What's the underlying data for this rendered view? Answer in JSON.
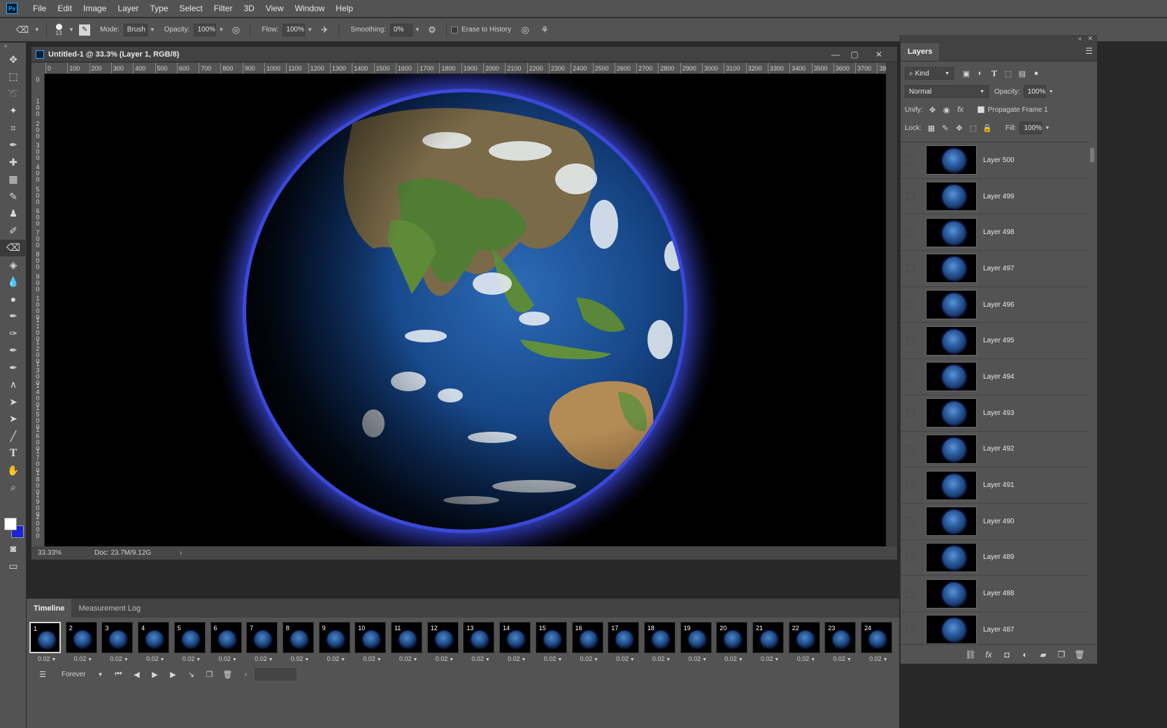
{
  "app": {
    "logo": "Ps"
  },
  "menu": [
    "File",
    "Edit",
    "Image",
    "Layer",
    "Type",
    "Select",
    "Filter",
    "3D",
    "View",
    "Window",
    "Help"
  ],
  "options": {
    "brush_size": "13",
    "mode_label": "Mode:",
    "mode_value": "Brush",
    "opacity_label": "Opacity:",
    "opacity_value": "100%",
    "flow_label": "Flow:",
    "flow_value": "100%",
    "smoothing_label": "Smoothing:",
    "smoothing_value": "0%",
    "erase_history_label": "Erase to History"
  },
  "document": {
    "title": "Untitled-1 @ 33.3% (Layer 1, RGB/8)",
    "zoom": "33.33%",
    "doc_size": "Doc: 23.7M/9.12G",
    "hruler": [
      "0",
      "100",
      "200",
      "300",
      "400",
      "500",
      "600",
      "700",
      "800",
      "900",
      "1000",
      "1100",
      "1200",
      "1300",
      "1400",
      "1500",
      "1600",
      "1700",
      "1800",
      "1900",
      "2000",
      "2100",
      "2200",
      "2300",
      "2400",
      "2500",
      "2600",
      "2700",
      "2800",
      "2900",
      "3000",
      "3100",
      "3200",
      "3300",
      "3400",
      "3500",
      "3600",
      "3700",
      "38"
    ],
    "vruler": [
      "0",
      "100",
      "200",
      "300",
      "400",
      "500",
      "600",
      "700",
      "800",
      "900",
      "1000",
      "1100",
      "1200",
      "1300",
      "1400",
      "1500",
      "1600",
      "1700",
      "1800",
      "1900",
      "2000"
    ]
  },
  "timeline": {
    "tabs": [
      "Timeline",
      "Measurement Log"
    ],
    "frames": [
      {
        "num": "1",
        "delay": "0.02"
      },
      {
        "num": "2",
        "delay": "0.02"
      },
      {
        "num": "3",
        "delay": "0.02"
      },
      {
        "num": "4",
        "delay": "0.02"
      },
      {
        "num": "5",
        "delay": "0.02"
      },
      {
        "num": "6",
        "delay": "0.02"
      },
      {
        "num": "7",
        "delay": "0.02"
      },
      {
        "num": "8",
        "delay": "0.02"
      },
      {
        "num": "9",
        "delay": "0.02"
      },
      {
        "num": "10",
        "delay": "0.02"
      },
      {
        "num": "11",
        "delay": "0.02"
      },
      {
        "num": "12",
        "delay": "0.02"
      },
      {
        "num": "13",
        "delay": "0.02"
      },
      {
        "num": "14",
        "delay": "0.02"
      },
      {
        "num": "15",
        "delay": "0.02"
      },
      {
        "num": "16",
        "delay": "0.02"
      },
      {
        "num": "17",
        "delay": "0.02"
      },
      {
        "num": "18",
        "delay": "0.02"
      },
      {
        "num": "19",
        "delay": "0.02"
      },
      {
        "num": "20",
        "delay": "0.02"
      },
      {
        "num": "21",
        "delay": "0.02"
      },
      {
        "num": "22",
        "delay": "0.02"
      },
      {
        "num": "23",
        "delay": "0.02"
      },
      {
        "num": "24",
        "delay": "0.02"
      }
    ],
    "loop": "Forever"
  },
  "layers_panel": {
    "tab": "Layers",
    "filter_kind": "Kind",
    "blend_mode": "Normal",
    "opacity_label": "Opacity:",
    "opacity_value": "100%",
    "unify_label": "Unify:",
    "propagate_label": "Propagate Frame 1",
    "lock_label": "Lock:",
    "fill_label": "Fill:",
    "fill_value": "100%",
    "layers": [
      "Layer 500",
      "Layer 499",
      "Layer 498",
      "Layer 497",
      "Layer 496",
      "Layer 495",
      "Layer 494",
      "Layer 493",
      "Layer 492",
      "Layer 491",
      "Layer 490",
      "Layer 489",
      "Layer 488",
      "Layer 487"
    ]
  },
  "colors": {
    "foreground": "#ffffff",
    "background": "#1a23d6",
    "atmosphere": "#3a49d8"
  }
}
